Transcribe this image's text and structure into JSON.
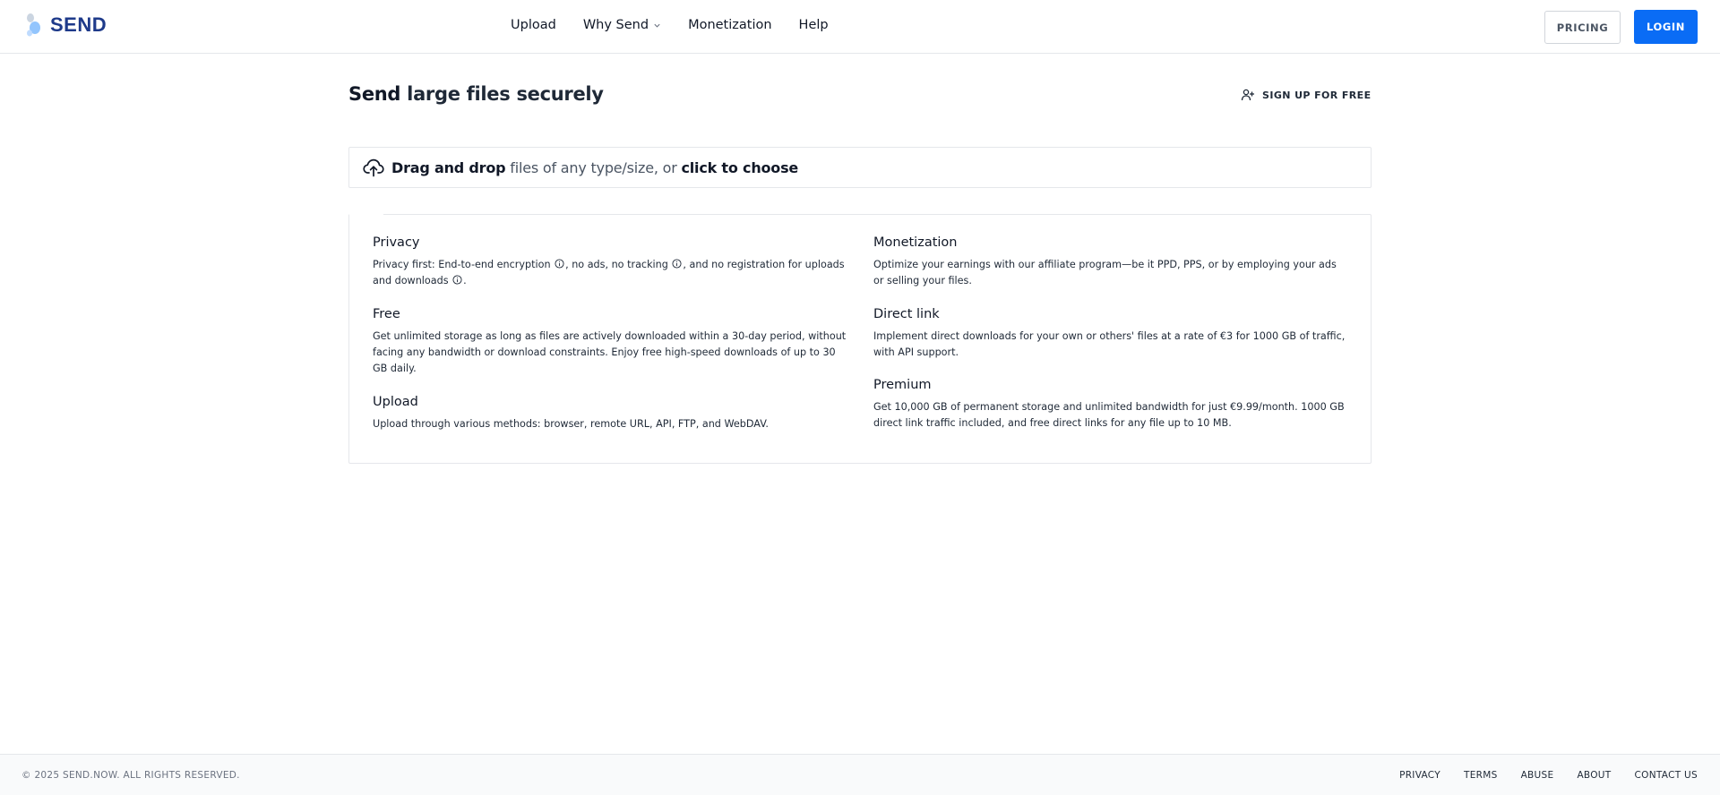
{
  "brand": {
    "name": "SEND",
    "logo_icon": "droplets-logo-icon"
  },
  "nav": {
    "items": [
      {
        "label": "Upload"
      },
      {
        "label": "Why Send",
        "has_dropdown": true
      },
      {
        "label": "Monetization"
      },
      {
        "label": "Help"
      }
    ]
  },
  "header": {
    "pricing_label": "PRICING",
    "login_label": "LOGIN"
  },
  "hero": {
    "title_bold": "Send",
    "title_rest": " large files securely",
    "signup_label": "SIGN UP FOR FREE",
    "signup_icon": "user-plus-icon"
  },
  "dropzone": {
    "icon": "cloud-upload-icon",
    "bold1": "Drag and drop",
    "middle": " files of any type/size, or ",
    "bold2": "click to choose"
  },
  "features": {
    "privacy": {
      "title": "Privacy",
      "t1": "Privacy first: End-to-end encryption ",
      "t2": ", no ads, no tracking ",
      "t3": ", and no registration for uploads and downloads ",
      "t4": "."
    },
    "free": {
      "title": "Free",
      "text": "Get unlimited storage as long as files are actively downloaded within a 30-day period, without facing any bandwidth or download constraints. Enjoy free high-speed downloads of up to 30 GB daily."
    },
    "upload": {
      "title": "Upload",
      "text": "Upload through various methods: browser, remote URL, API, FTP, and WebDAV."
    },
    "monetization": {
      "title": "Monetization",
      "text": "Optimize your earnings with our affiliate program—be it PPD, PPS, or by employing your ads or selling your files."
    },
    "direct_link": {
      "title": "Direct link",
      "text": "Implement direct downloads for your own or others' files at a rate of €3 for 1000 GB of traffic, with API support."
    },
    "premium": {
      "title": "Premium",
      "text": "Get 10,000 GB of permanent storage and unlimited bandwidth for just €9.99/month. 1000 GB direct link traffic included, and free direct links for any file up to 10 MB."
    }
  },
  "footer": {
    "copyright": "© 2025 SEND.NOW. ALL RIGHTS RESERVED.",
    "links": [
      {
        "label": "PRIVACY"
      },
      {
        "label": "TERMS"
      },
      {
        "label": "ABUSE"
      },
      {
        "label": "ABOUT"
      },
      {
        "label": "CONTACT US"
      }
    ]
  },
  "colors": {
    "accent": "#0a6cf5",
    "brand_text": "#1e3a8a",
    "border": "#e5e7eb"
  }
}
